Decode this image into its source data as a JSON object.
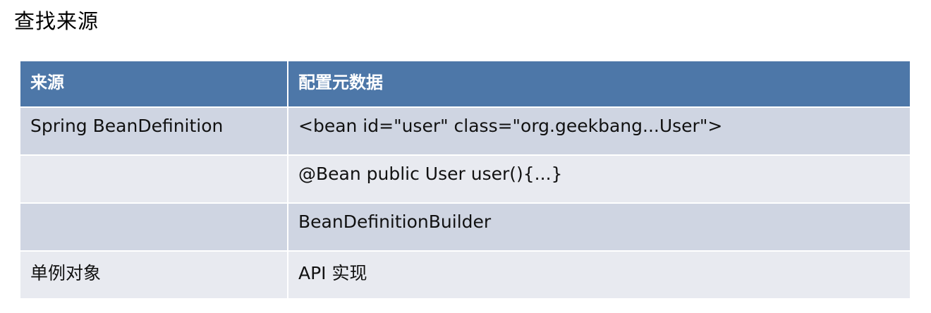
{
  "page": {
    "title": "查找来源"
  },
  "table": {
    "headers": [
      "来源",
      "配置元数据"
    ],
    "rows": [
      {
        "source": "Spring BeanDefinition",
        "metadata": "<bean id=\"user\" class=\"org.geekbang...User\">"
      },
      {
        "source": "",
        "metadata": "@Bean public User user(){...}"
      },
      {
        "source": "",
        "metadata": "BeanDefinitionBuilder"
      },
      {
        "source": "单例对象",
        "metadata": "API 实现"
      }
    ]
  },
  "colors": {
    "header_bg": "#4d77a8",
    "row_odd_bg": "#cfd5e2",
    "row_even_bg": "#e8eaf0"
  }
}
